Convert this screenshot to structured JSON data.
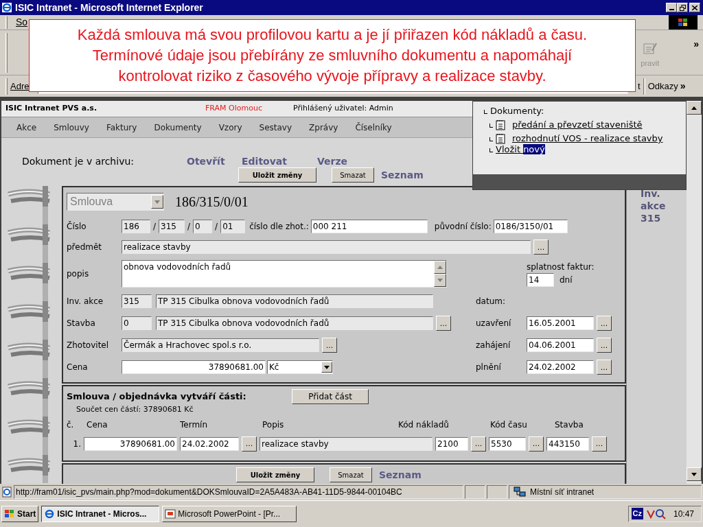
{
  "window": {
    "title": "ISIC Intranet - Microsoft Internet Explorer"
  },
  "browser": {
    "menu_fragment": "So",
    "toolbar_fragment": "pravit",
    "toolbar_overflow": "»",
    "address_label": "Adre",
    "go_fragment": "t",
    "links_label": "Odkazy",
    "links_overflow": "»"
  },
  "callout": {
    "lines": [
      "Každá smlouva má svou profilovou kartu a je jí přiřazen kód nákladů a času.",
      "Termínové údaje jsou přebírány ze smluvního dokumentu a napomáhají",
      "kontrolovat riziko z časového vývoje přípravy a realizace stavby."
    ]
  },
  "header": {
    "company": "ISIC Intranet PVS a.s.",
    "location": "FRAM Olomouc",
    "user": "Přihlášený uživatel: Admin"
  },
  "nav": [
    {
      "label": "Akce"
    },
    {
      "label": "Smlouvy"
    },
    {
      "label": "Faktury"
    },
    {
      "label": "Dokumenty"
    },
    {
      "label": "Vzory"
    },
    {
      "label": "Sestavy"
    },
    {
      "label": "Zprávy"
    },
    {
      "label": "Číselníky"
    }
  ],
  "actions": {
    "archive_label": "Dokument je v archivu:",
    "links": [
      "Otevřít",
      "Editovat",
      "Verze"
    ],
    "save": "Uložit změny",
    "delete": "Smazat",
    "list": "Seznam"
  },
  "popup": {
    "heading": "Dokumenty:",
    "documents": [
      "předání a převzetí staveniště",
      "rozhodnutí VOS - realizace stavby"
    ],
    "new_link": "Vložit",
    "new_link_selected": "nový"
  },
  "side": {
    "lines": [
      "Inv.",
      "akce",
      "315"
    ]
  },
  "form": {
    "doc_type": "Smlouva",
    "doc_number": "186/315/0/01",
    "number": {
      "label": "Číslo",
      "parts": [
        "186",
        "315",
        "0",
        "01"
      ],
      "separators": [
        "/",
        "/",
        "/"
      ]
    },
    "contractor_number": {
      "label": "číslo dle zhot.:",
      "value": "000 211"
    },
    "original_number": {
      "label": "původní číslo:",
      "value": "0186/3150/01"
    },
    "subject": {
      "label": "předmět",
      "value": "realizace stavby",
      "button": "..."
    },
    "description": {
      "label": "popis",
      "value": "obnova vodovodních řadů"
    },
    "payment_due": {
      "label": "splatnost faktur:",
      "value": "14",
      "unit": "dní"
    },
    "investment": {
      "label": "Inv. akce",
      "code": "315",
      "name": "TP 315 Cibulka obnova vodovodních řadů"
    },
    "construction": {
      "label": "Stavba",
      "code": "0",
      "name": "TP 315 Cibulka obnova vodovodních řadů",
      "button": "..."
    },
    "contractor": {
      "label": "Zhotovitel",
      "value": "Čermák a Hrachovec spol.s r.o.",
      "button": "..."
    },
    "price": {
      "label": "Cena",
      "value": "37890681.00",
      "currency": "Kč"
    },
    "dates_label": "datum:",
    "dates": [
      {
        "label": "uzavření",
        "value": "16.05.2001",
        "button": "..."
      },
      {
        "label": "zahájení",
        "value": "04.06.2001",
        "button": "..."
      },
      {
        "label": "plnění",
        "value": "24.02.2002",
        "button": "..."
      }
    ]
  },
  "parts": {
    "title": "Smlouva / objednávka vytváří části:",
    "add_button": "Přidat část",
    "sum": "Součet cen částí: 37890681 Kč",
    "columns": [
      "č.",
      "Cena",
      "Termín",
      "Popis",
      "Kód nákladů",
      "Kód času",
      "Stavba"
    ],
    "rows": [
      {
        "no": "1.",
        "price": "37890681.00",
        "date": "24.02.2002",
        "date_button": "...",
        "description": "realizace stavby",
        "cost_code": "2100",
        "cost_button": "...",
        "time_code": "5530",
        "time_button": "...",
        "construction": "443150",
        "construction_button": "..."
      }
    ]
  },
  "bottom_actions": {
    "save": "Uložit změny",
    "delete": "Smazat",
    "list": "Seznam"
  },
  "status_bar": {
    "url": "http://fram01/isic_pvs/main.php?mod=dokument&DOKSmlouvaID=2A5A483A-AB41-11D5-9844-00104BC",
    "zone": "Místní síť intranet"
  },
  "taskbar": {
    "start": "Start",
    "tasks": [
      {
        "label": "ISIC Intranet - Micros...",
        "selected": true
      },
      {
        "label": "Microsoft PowerPoint - [Pr...",
        "selected": false
      }
    ],
    "language": "Cz",
    "time": "10:47"
  }
}
